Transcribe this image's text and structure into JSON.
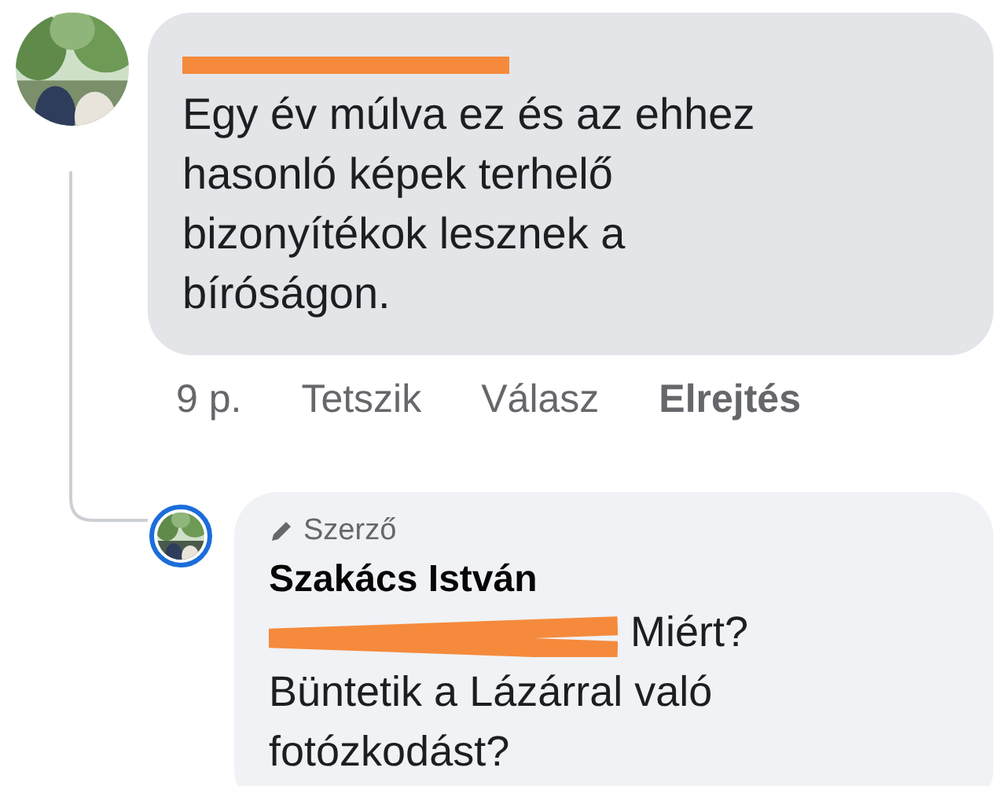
{
  "comments": [
    {
      "author_redacted": true,
      "text": "Egy év múlva ez és az ehhez hasonló képek terhelő bizonyítékok lesznek a bíróságon.",
      "actions": [
        {
          "label": "9 p.",
          "kind": "time"
        },
        {
          "label": "Tetszik",
          "kind": "link"
        },
        {
          "label": "Válasz",
          "kind": "link"
        },
        {
          "label": "Elrejtés",
          "kind": "strong"
        }
      ],
      "replies": [
        {
          "badge": "Szerző",
          "author": "Szakács István",
          "mention_redacted": true,
          "text": "Miért? Büntetik a Lázárral való fotózkodást?"
        }
      ]
    }
  ]
}
